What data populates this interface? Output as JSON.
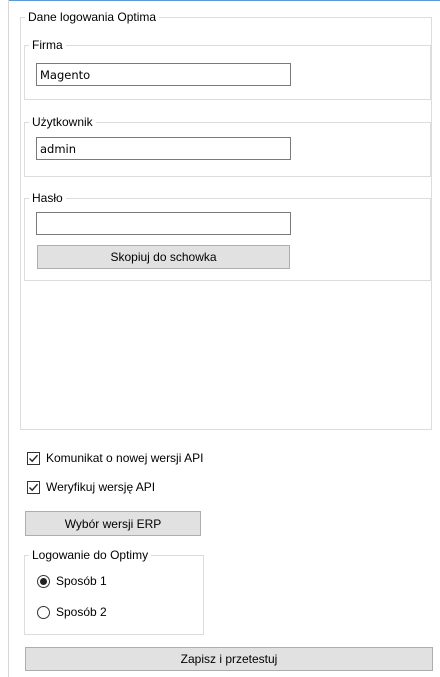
{
  "login_group": {
    "title": "Dane logowania Optima",
    "firma": {
      "label": "Firma",
      "value": "Magento"
    },
    "user": {
      "label": "Użytkownik",
      "value": "admin"
    },
    "password": {
      "label": "Hasło",
      "value": "",
      "copy_button": "Skopiuj do schowka"
    }
  },
  "options": {
    "api_notice": {
      "label": "Komunikat o nowej wersji API",
      "checked": true
    },
    "api_verify": {
      "label": "Weryfikuj wersję API",
      "checked": true
    },
    "erp_button": "Wybór wersji ERP"
  },
  "login_method": {
    "title": "Logowanie do Optimy",
    "options": [
      {
        "label": "Sposób 1",
        "selected": true
      },
      {
        "label": "Sposób 2",
        "selected": false
      }
    ]
  },
  "save_button": "Zapisz i przetestuj"
}
